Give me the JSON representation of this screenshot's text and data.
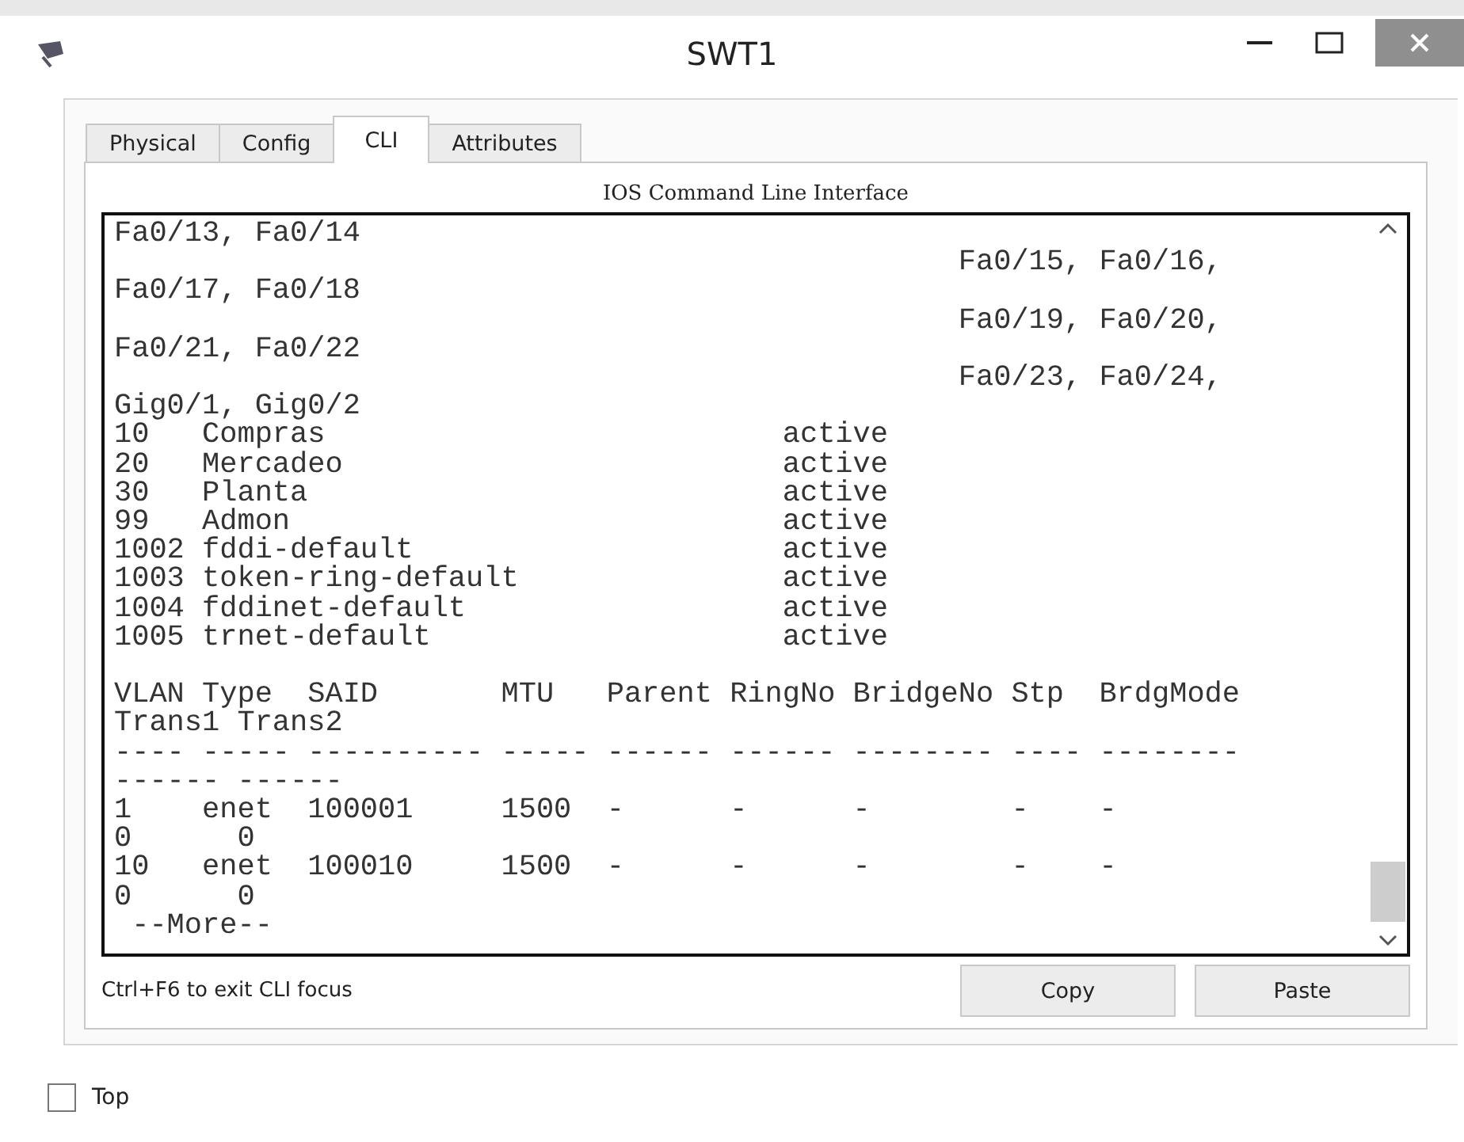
{
  "window": {
    "title": "SWT1"
  },
  "tabs": [
    {
      "label": "Physical",
      "selected": false
    },
    {
      "label": "Config",
      "selected": false
    },
    {
      "label": "CLI",
      "selected": true
    },
    {
      "label": "Attributes",
      "selected": false
    }
  ],
  "cli": {
    "heading": "IOS Command Line Interface",
    "blocks": [
      {
        "lines": [
          "Fa0/13, Fa0/14",
          "                                                Fa0/15, Fa0/16,",
          "Fa0/17, Fa0/18",
          "                                                Fa0/19, Fa0/20,",
          "Fa0/21, Fa0/22",
          "                                                Fa0/23, Fa0/24,",
          "Gig0/1, Gig0/2",
          "10   Compras                          active",
          "20   Mercadeo                         active",
          "30   Planta                           active",
          "99   Admon                            active",
          "1002 fddi-default                     active",
          "1003 token-ring-default               active",
          "1004 fddinet-default                  active",
          "1005 trnet-default                    active"
        ]
      },
      {
        "lines": [
          "VLAN Type  SAID       MTU   Parent RingNo BridgeNo Stp  BrdgMode",
          "Trans1 Trans2",
          "---- ----- ---------- ----- ------ ------ -------- ---- --------",
          "------ ------",
          "1    enet  100001     1500  -      -      -        -    -",
          "0      0",
          "10   enet  100010     1500  -      -      -        -    -",
          "0      0",
          " --More--"
        ]
      }
    ],
    "hint": "Ctrl+F6 to exit CLI focus",
    "buttons": [
      "Copy",
      "Paste"
    ]
  },
  "top_option": {
    "label": "Top",
    "checked": false
  }
}
